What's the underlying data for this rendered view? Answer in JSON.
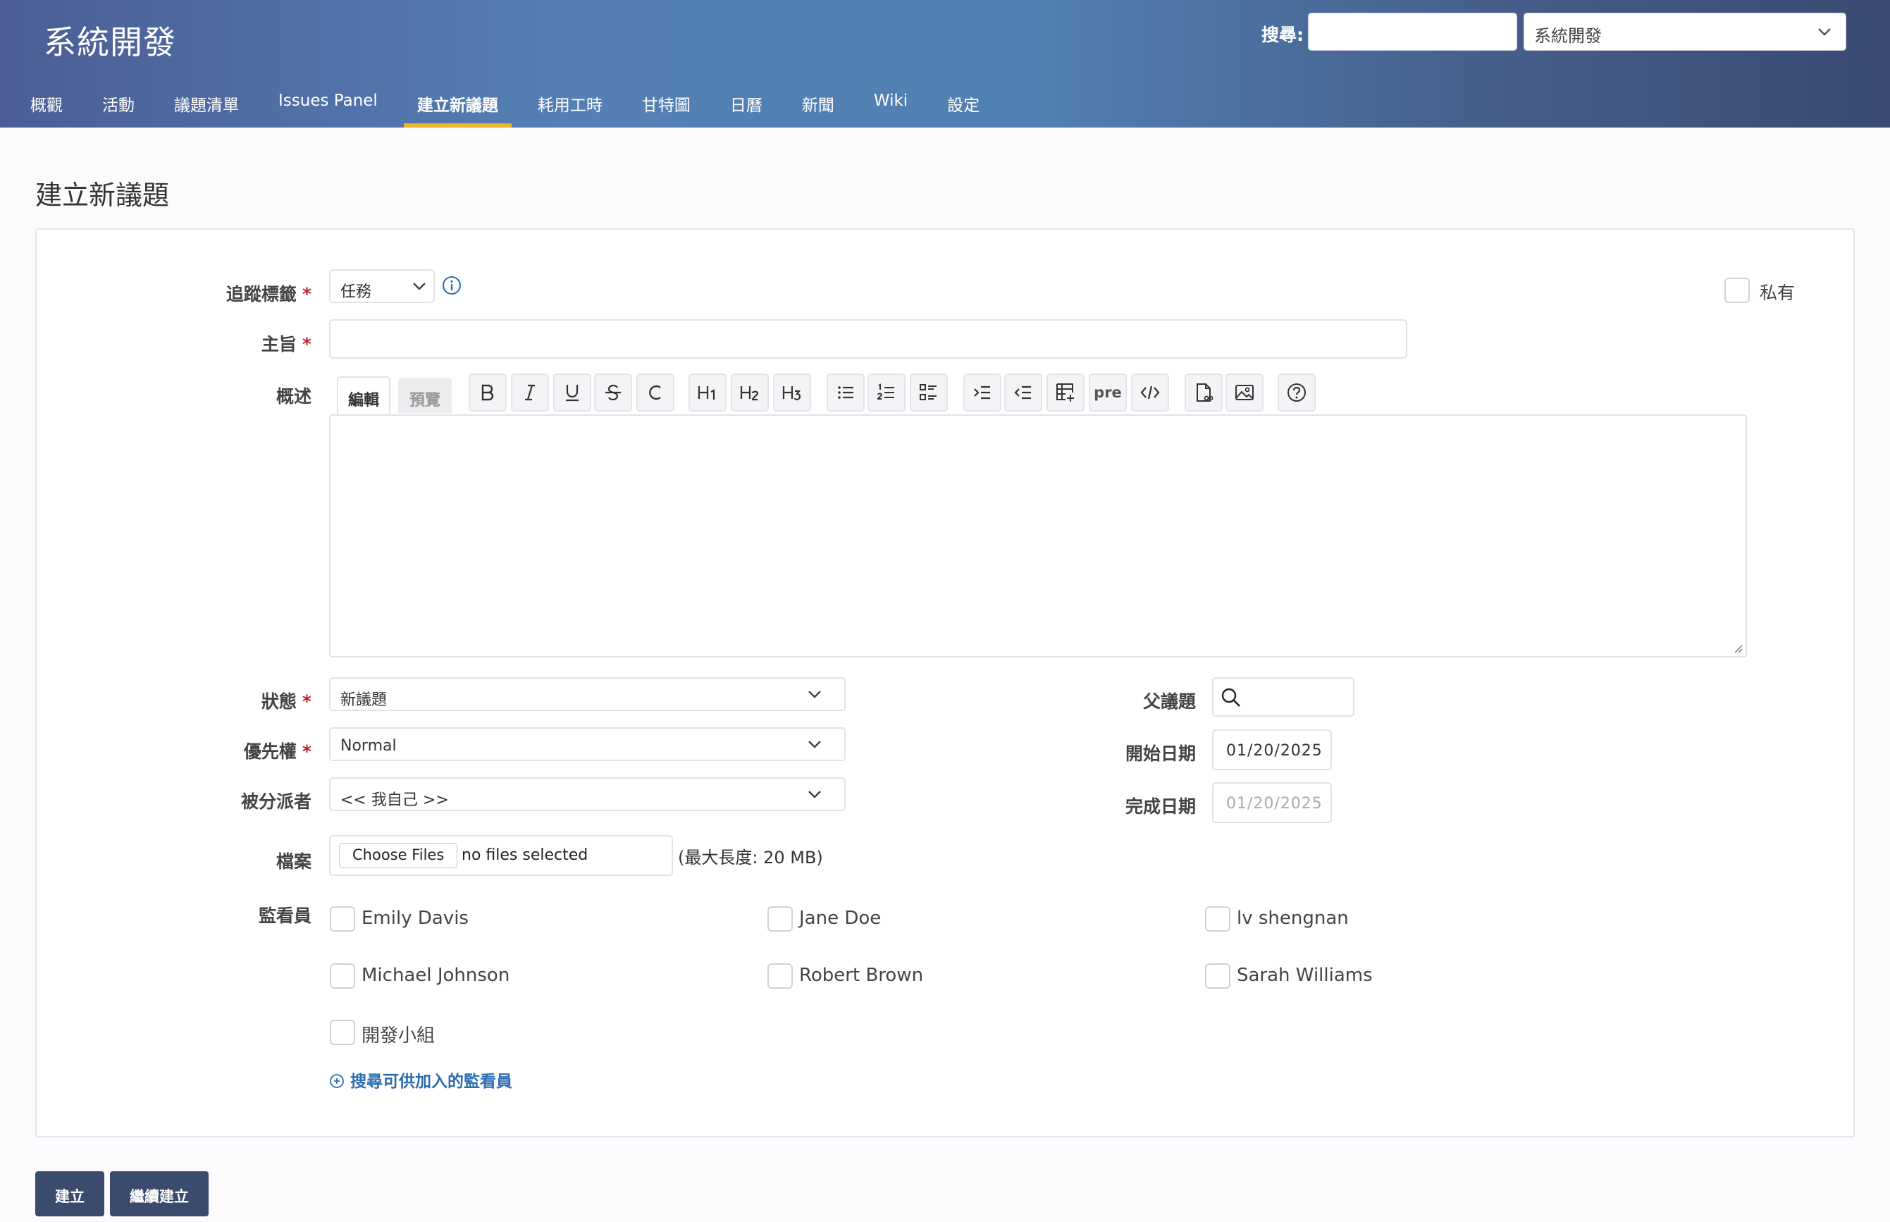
{
  "header": {
    "app_title": "系統開發",
    "search_label": "搜尋:",
    "search_value": "",
    "project_select": "系統開發"
  },
  "tabs": [
    {
      "label": "概觀"
    },
    {
      "label": "活動"
    },
    {
      "label": "議題清單"
    },
    {
      "label": "Issues Panel"
    },
    {
      "label": "建立新議題",
      "active": true
    },
    {
      "label": "耗用工時"
    },
    {
      "label": "甘特圖"
    },
    {
      "label": "日曆"
    },
    {
      "label": "新聞"
    },
    {
      "label": "Wiki"
    },
    {
      "label": "設定"
    }
  ],
  "page": {
    "title": "建立新議題"
  },
  "form": {
    "tracker": {
      "label": "追蹤標籤",
      "value": "任務"
    },
    "private": {
      "label": "私有"
    },
    "subject": {
      "label": "主旨",
      "value": ""
    },
    "description": {
      "label": "概述",
      "edit_tab": "編輯",
      "preview_tab": "預覽",
      "pre_label": "pre",
      "toolbar_icons": [
        "bold-icon",
        "italic-icon",
        "underline-icon",
        "strikethrough-icon",
        "code-inline-icon",
        "h1-icon",
        "h2-icon",
        "h3-icon",
        "bullet-list-icon",
        "numbered-list-icon",
        "task-list-icon",
        "indent-icon",
        "outdent-icon",
        "table-icon",
        "pre-icon",
        "code-block-icon",
        "attach-file-icon",
        "image-icon",
        "help-icon"
      ]
    },
    "status": {
      "label": "狀態",
      "value": "新議題"
    },
    "priority": {
      "label": "優先權",
      "value": "Normal"
    },
    "assignee": {
      "label": "被分派者",
      "value": "<< 我自己 >>"
    },
    "parent": {
      "label": "父議題",
      "value": ""
    },
    "start_date": {
      "label": "開始日期",
      "value": "01/20/2025"
    },
    "due_date": {
      "label": "完成日期",
      "value": "01/20/2025"
    },
    "files": {
      "label": "檔案",
      "button": "Choose Files",
      "status": "no files selected",
      "hint": "(最大長度: 20 MB)"
    },
    "watchers": {
      "label": "監看員",
      "people": [
        "Emily Davis",
        "Jane Doe",
        "lv shengnan",
        "Michael Johnson",
        "Robert Brown",
        "Sarah Williams",
        "開發小組"
      ],
      "search_link": "搜尋可供加入的監看員"
    }
  },
  "actions": {
    "create": "建立",
    "create_continue": "繼續建立"
  },
  "colors": {
    "accent": "#f1b52c",
    "button": "#3b4b6d",
    "link": "#2b6cb0",
    "required": "#b23333"
  }
}
